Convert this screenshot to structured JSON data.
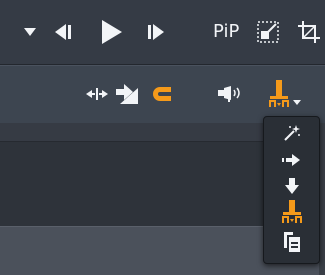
{
  "transport": {
    "pip_label": "PiP"
  },
  "icons": {
    "playback_menu": "dropdown-arrow-icon",
    "previous_frame": "step-back-icon",
    "play": "play-icon",
    "next_frame": "step-forward-icon",
    "pip": "pip-icon",
    "crop": "crop-icon",
    "split": "split-clip-icon",
    "trim": "ripple-trim-icon",
    "magnet": "magnet-icon",
    "audio_scrub": "audio-scrub-icon",
    "insert_mode": "insert-mode-icon"
  },
  "insert_mode_menu": {
    "items": [
      {
        "id": "smart",
        "icon": "magic-wand-icon"
      },
      {
        "id": "insert",
        "icon": "arrow-right-icon"
      },
      {
        "id": "overwrite",
        "icon": "arrow-down-icon"
      },
      {
        "id": "ripple",
        "icon": "ripple-insert-icon",
        "active": true
      },
      {
        "id": "replace",
        "icon": "replace-clip-icon"
      }
    ]
  },
  "colors": {
    "accent": "#f59a1a",
    "icon": "#f2f4f7",
    "background": "#2b3038"
  }
}
